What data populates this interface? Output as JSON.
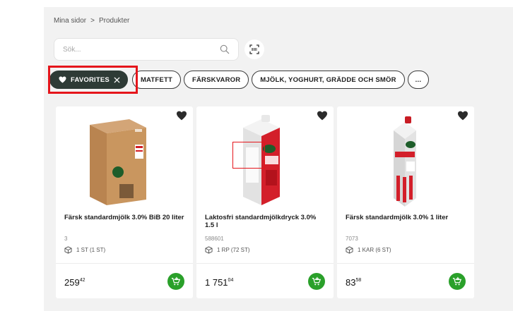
{
  "breadcrumb": {
    "parent": "Mina sidor",
    "separator": ">",
    "current": "Produkter"
  },
  "search": {
    "placeholder": "Sök..."
  },
  "filters": {
    "favorites_label": "FAVORITES",
    "chips": [
      "MATFETT",
      "FÄRSKVAROR",
      "MJÖLK, YOGHURT, GRÄDDE OCH SMÖR",
      "..."
    ]
  },
  "products": [
    {
      "name": "Färsk standardmjölk 3.0% BiB 20 liter",
      "article_no": "3",
      "pack": "1 ST (1 ST)",
      "price_main": "259",
      "price_dec": "42"
    },
    {
      "name": "Laktosfri standardmjölkdryck 3.0% 1.5 l",
      "article_no": "588601",
      "pack": "1 RP (72 ST)",
      "price_main": "1 751",
      "price_dec": "04"
    },
    {
      "name": "Färsk standardmjölk 3.0% 1 liter",
      "article_no": "7073",
      "pack": "1 KAR (6 ST)",
      "price_main": "83",
      "price_dec": "58"
    }
  ],
  "colors": {
    "chip_active": "#2e3b36",
    "cart_green": "#2aa02a",
    "highlight_red": "#e5151b",
    "panel_bg": "#f2f2f2"
  },
  "icons": {
    "search": "search-icon",
    "scan": "barcode-scan-icon",
    "heart": "heart-icon",
    "close": "close-icon",
    "package": "package-icon",
    "cart": "add-to-cart-icon"
  }
}
